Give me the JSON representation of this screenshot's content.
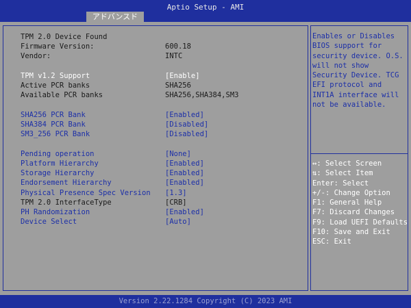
{
  "window": {
    "title": "Aptio Setup - AMI"
  },
  "tabs": [
    {
      "label": "アドバンスド",
      "active": true
    }
  ],
  "settings": {
    "device_found": "TPM 2.0 Device Found",
    "firmware": {
      "label": "Firmware Version:",
      "value": "600.18"
    },
    "vendor": {
      "label": "Vendor:",
      "value": "INTC"
    },
    "tpm_v12_support": {
      "label": "TPM v1.2 Support",
      "value": "[Enable]"
    },
    "active_pcr_banks": {
      "label": "Active PCR banks",
      "value": "SHA256"
    },
    "available_pcr_banks": {
      "label": "Available PCR banks",
      "value": "SHA256,SHA384,SM3"
    },
    "sha256_bank": {
      "label": "SHA256 PCR Bank",
      "value": "[Enabled]"
    },
    "sha384_bank": {
      "label": "SHA384 PCR Bank",
      "value": "[Disabled]"
    },
    "sm3_bank": {
      "label": "SM3_256 PCR Bank",
      "value": "[Disabled]"
    },
    "pending_operation": {
      "label": "Pending operation",
      "value": "[None]"
    },
    "platform_hierarchy": {
      "label": "Platform Hierarchy",
      "value": "[Enabled]"
    },
    "storage_hierarchy": {
      "label": "Storage Hierarchy",
      "value": "[Enabled]"
    },
    "endorsement_hierarchy": {
      "label": "Endorsement Hierarchy",
      "value": "[Enabled]"
    },
    "physical_presence": {
      "label": "Physical Presence Spec Version",
      "value": "[1.3]"
    },
    "interface_type": {
      "label": "TPM 2.0 InterfaceType",
      "value": "[CRB]"
    },
    "ph_randomization": {
      "label": "PH Randomization",
      "value": "[Enabled]"
    },
    "device_select": {
      "label": "Device Select",
      "value": "[Auto]"
    }
  },
  "help": {
    "text": "Enables or Disables\nBIOS support for\nsecurity device. O.S.\nwill not show\nSecurity Device. TCG\nEFI protocol and\nINT1A interface will\nnot be available."
  },
  "keys": [
    "↔: Select Screen",
    "⇅: Select Item",
    "Enter: Select",
    "+/-: Change Option",
    "F1: General Help",
    "F7: Discard Changes",
    "F9: Load UEFI Defaults",
    "F10: Save and Exit",
    "ESC: Exit"
  ],
  "footer": {
    "text": "Version 2.22.1284 Copyright (C) 2023 AMI"
  },
  "colors": {
    "background": "#9e9e9e",
    "bar": "#1f2f9e",
    "link_text": "#1c2fa8",
    "static_text": "#1a1a1a",
    "selected_text": "#ffffff"
  }
}
